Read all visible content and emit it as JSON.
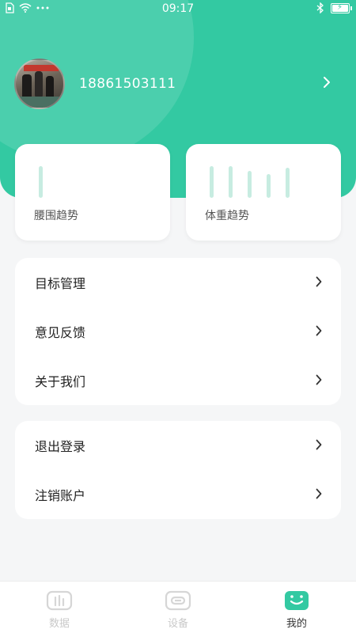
{
  "status_bar": {
    "time": "09:17",
    "left_icons": [
      "sim-icon",
      "wifi-icon",
      "more-dots-icon"
    ],
    "right_icons": [
      "bluetooth-icon",
      "battery-charging-icon"
    ]
  },
  "profile": {
    "phone": "18861503111"
  },
  "trend_cards": [
    {
      "label": "腰围趋势",
      "bar_levels": [
        1.0
      ]
    },
    {
      "label": "体重趋势",
      "bar_levels": [
        1.0,
        1.0,
        0.85,
        0.75,
        0.95
      ]
    }
  ],
  "menu_group_1": [
    "目标管理",
    "意见反馈",
    "关于我们"
  ],
  "menu_group_2": [
    "退出登录",
    "注销账户"
  ],
  "tab_bar": [
    {
      "label": "数据",
      "icon": "data-chart-icon",
      "active": false
    },
    {
      "label": "设备",
      "icon": "device-link-icon",
      "active": false
    },
    {
      "label": "我的",
      "icon": "profile-smile-icon",
      "active": true
    }
  ],
  "colors": {
    "primary": "#33c9a2",
    "trend_bar": "#c7ece1",
    "inactive_tab": "#d0d0d0"
  }
}
